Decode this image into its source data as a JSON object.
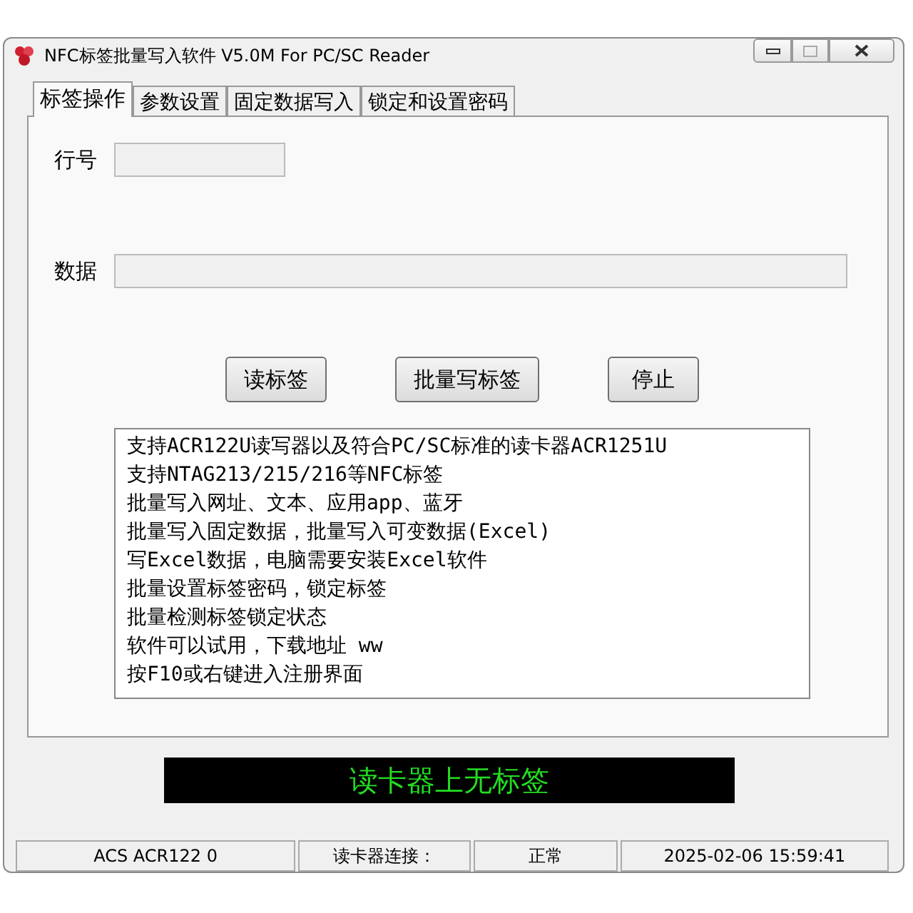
{
  "window": {
    "title": "NFC标签批量写入软件 V5.0M For PC/SC Reader"
  },
  "tabs": [
    {
      "label": "标签操作",
      "selected": true
    },
    {
      "label": "参数设置",
      "selected": false
    },
    {
      "label": "固定数据写入",
      "selected": false
    },
    {
      "label": "锁定和设置密码",
      "selected": false
    }
  ],
  "fields": [
    {
      "label": "行号",
      "kind": "short"
    },
    {
      "label": "数据",
      "kind": "long"
    }
  ],
  "buttons": [
    "读标签",
    "批量写标签",
    "停止"
  ],
  "info_lines": [
    "支持ACR122U读写器以及符合PC/SC标准的读卡器ACR1251U",
    "支持NTAG213/215/216等NFC标签",
    "批量写入网址、文本、应用app、蓝牙",
    "批量写入固定数据，批量写入可变数据(Excel)",
    "写Excel数据，电脑需要安装Excel软件",
    "批量设置标签密码，锁定标签",
    "批量检测标签锁定状态",
    "软件可以试用，下载地址 ww",
    "按F10或右键进入注册界面"
  ],
  "status_message": "读卡器上无标签",
  "status_bar": [
    "ACS ACR122 0",
    "读卡器连接：",
    "正常",
    "2025-02-06 15:59:41"
  ]
}
